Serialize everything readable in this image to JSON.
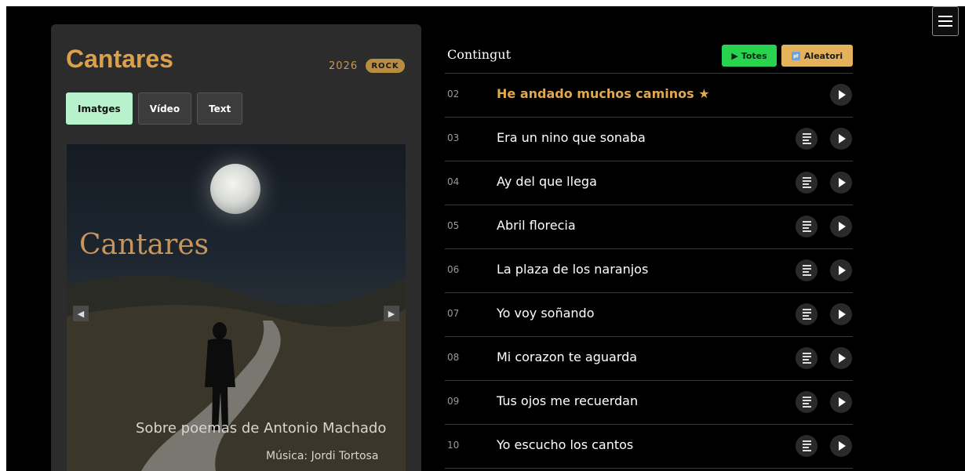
{
  "album": {
    "title": "Cantares",
    "year": "2026",
    "genre": "ROCK",
    "tabs": [
      {
        "label": "Imatges",
        "active": true
      },
      {
        "label": "Vídeo",
        "active": false
      },
      {
        "label": "Text",
        "active": false
      }
    ],
    "artwork": {
      "title": "Cantares",
      "subtitle": "Sobre poemas de Antonio Machado",
      "music": "Música: Jordi Tortosa"
    }
  },
  "content": {
    "title": "Contingut",
    "play_all_label": "Totes",
    "shuffle_label": "Aleatori",
    "tracks": [
      {
        "number": "02",
        "title": "He andado muchos caminos ★",
        "current": true,
        "has_lyrics": false
      },
      {
        "number": "03",
        "title": "Era un nino que sonaba",
        "current": false,
        "has_lyrics": true
      },
      {
        "number": "04",
        "title": "Ay del que llega",
        "current": false,
        "has_lyrics": true
      },
      {
        "number": "05",
        "title": "Abril florecia",
        "current": false,
        "has_lyrics": true
      },
      {
        "number": "06",
        "title": "La plaza de los naranjos",
        "current": false,
        "has_lyrics": true
      },
      {
        "number": "07",
        "title": "Yo voy soñando",
        "current": false,
        "has_lyrics": true
      },
      {
        "number": "08",
        "title": "Mi corazon te aguarda",
        "current": false,
        "has_lyrics": true
      },
      {
        "number": "09",
        "title": "Tus ojos me recuerdan",
        "current": false,
        "has_lyrics": true
      },
      {
        "number": "10",
        "title": "Yo escucho los cantos",
        "current": false,
        "has_lyrics": true
      }
    ]
  },
  "colors": {
    "accent": "#dca04a",
    "play_all": "#2ad34f",
    "shuffle": "#e4b25a",
    "active_tab": "#b8f2cc"
  }
}
